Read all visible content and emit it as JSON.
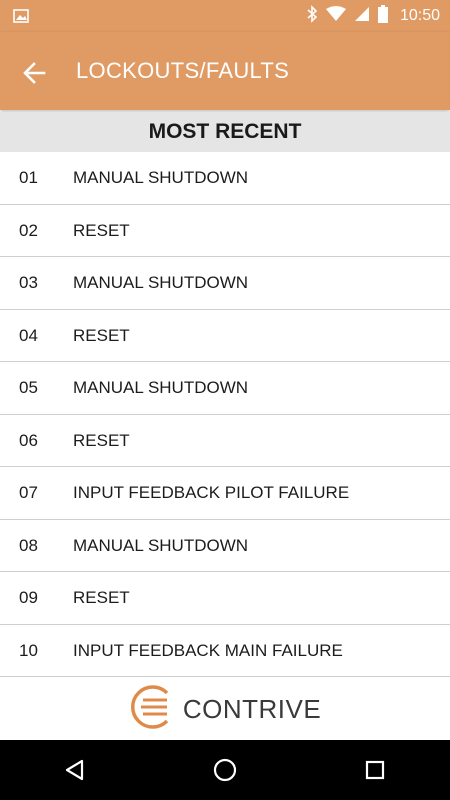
{
  "status_bar": {
    "time": "10:50",
    "icons": [
      "image-notification-icon",
      "bluetooth-icon",
      "wifi-icon",
      "signal-icon",
      "battery-icon"
    ]
  },
  "app_bar": {
    "back_icon": "arrow-left-icon",
    "title": "LOCKOUTS/FAULTS",
    "background": "#e09a63"
  },
  "section": {
    "title": "MOST RECENT"
  },
  "faults": [
    {
      "num": "01",
      "text": "MANUAL SHUTDOWN"
    },
    {
      "num": "02",
      "text": "RESET"
    },
    {
      "num": "03",
      "text": "MANUAL SHUTDOWN"
    },
    {
      "num": "04",
      "text": "RESET"
    },
    {
      "num": "05",
      "text": "MANUAL SHUTDOWN"
    },
    {
      "num": "06",
      "text": "RESET"
    },
    {
      "num": "07",
      "text": "INPUT FEEDBACK PILOT FAILURE"
    },
    {
      "num": "08",
      "text": "MANUAL SHUTDOWN"
    },
    {
      "num": "09",
      "text": "RESET"
    },
    {
      "num": "10",
      "text": "INPUT FEEDBACK MAIN FAILURE"
    }
  ],
  "footer": {
    "logo_text": "CONTRIVE",
    "logo_color": "#e08a4a"
  },
  "nav_bar": {
    "icons": [
      "back-triangle-icon",
      "home-circle-icon",
      "recents-square-icon"
    ]
  }
}
